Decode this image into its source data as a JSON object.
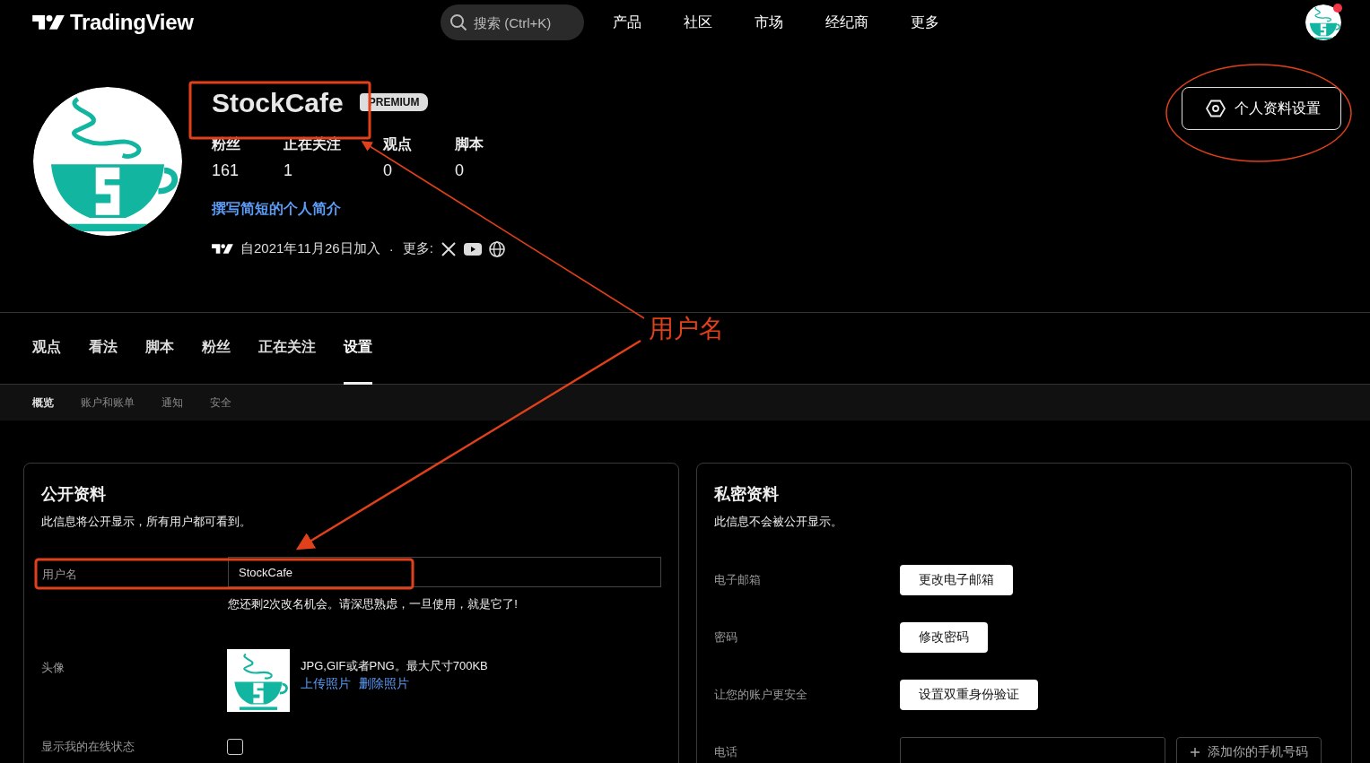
{
  "header": {
    "logo": "TradingView",
    "search_placeholder": "搜索 (Ctrl+K)",
    "nav": [
      "产品",
      "社区",
      "市场",
      "经纪商",
      "更多"
    ],
    "notification": true
  },
  "profile": {
    "name": "StockCafe",
    "badge": "PREMIUM",
    "stats": [
      {
        "label": "粉丝",
        "value": "161"
      },
      {
        "label": "正在关注",
        "value": "1"
      },
      {
        "label": "观点",
        "value": "0"
      },
      {
        "label": "脚本",
        "value": "0"
      }
    ],
    "bio_link": "撰写简短的个人简介",
    "joined": "自2021年11月26日加入",
    "separator": "·",
    "more_label": "更多:",
    "settings_button": "个人资料设置"
  },
  "tabs": [
    {
      "label": "观点",
      "selected": false
    },
    {
      "label": "看法",
      "selected": false
    },
    {
      "label": "脚本",
      "selected": false
    },
    {
      "label": "粉丝",
      "selected": false
    },
    {
      "label": "正在关注",
      "selected": false
    },
    {
      "label": "设置",
      "selected": true
    }
  ],
  "subtabs": [
    {
      "label": "概览",
      "selected": true
    },
    {
      "label": "账户和账单",
      "selected": false
    },
    {
      "label": "通知",
      "selected": false
    },
    {
      "label": "安全",
      "selected": false
    }
  ],
  "public_profile": {
    "title": "公开资料",
    "description": "此信息将公开显示，所有用户都可看到。",
    "username": {
      "label": "用户名",
      "value": "StockCafe",
      "hint": "您还剩2次改名机会。请深思熟虑，一旦使用，就是它了!"
    },
    "avatar": {
      "label": "头像",
      "info": "JPG,GIF或者PNG。最大尺寸700KB",
      "upload_link": "上传照片",
      "delete_link": "删除照片"
    },
    "online_status": {
      "label": "显示我的在线状态",
      "checked": false
    }
  },
  "private_profile": {
    "title": "私密资料",
    "description": "此信息不会被公开显示。",
    "rows": [
      {
        "label": "电子邮箱",
        "kind": "button",
        "button": "更改电子邮箱"
      },
      {
        "label": "密码",
        "kind": "button",
        "button": "修改密码"
      },
      {
        "label": "让您的账户更安全",
        "kind": "button",
        "button": "设置双重身份验证"
      },
      {
        "label": "电话",
        "kind": "phone",
        "button": "添加你的手机号码"
      }
    ]
  },
  "annotation": {
    "label": "用户名"
  }
}
